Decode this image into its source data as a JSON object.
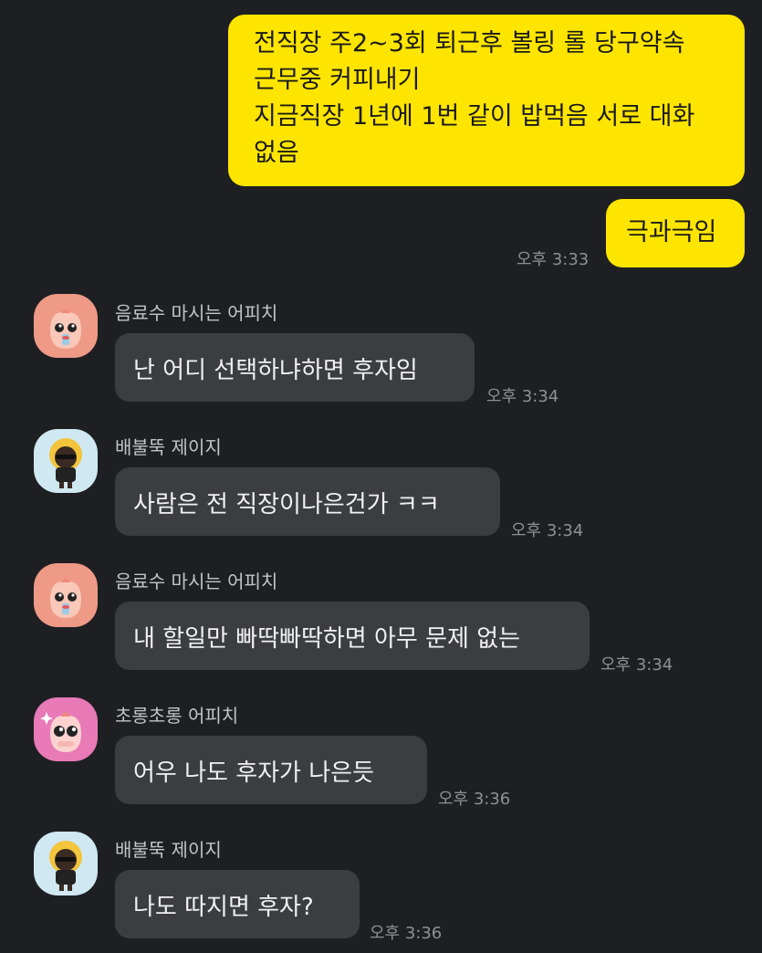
{
  "messages_out": {
    "main_lines": [
      "전직장 주2~3회 퇴근후 볼링 롤 당구약속",
      "근무중 커피내기",
      "지금직장 1년에 1번 같이 밥먹음 서로 대화",
      "없음"
    ],
    "second": "극과극임",
    "time": "오후 3:33"
  },
  "messages_in": [
    {
      "sender": "음료수 마시는 어피치",
      "text": "난 어디 선택하냐하면 후자임",
      "time": "오후 3:34"
    },
    {
      "sender": "배불뚝 제이지",
      "text": "사람은 전 직장이나은건가 ㅋㅋ",
      "time": "오후 3:34"
    },
    {
      "sender": "음료수 마시는 어피치",
      "text": "내 할일만 빠딱빠딱하면 아무 문제 없는",
      "time": "오후 3:34"
    },
    {
      "sender": "초롱초롱 어피치",
      "text": "어우 나도 후자가 나은듯",
      "time": "오후 3:36"
    },
    {
      "sender": "배불뚝 제이지",
      "text": "나도 따지면 후자?",
      "time": "오후 3:36"
    }
  ],
  "colors": {
    "background": "#1e1f22",
    "outgoing_bubble": "#fee500",
    "incoming_bubble": "#3c3d41",
    "timestamp": "#8f9095"
  },
  "avatar_icons": [
    "apeach-drink-icon",
    "jayg-icon",
    "apeach-drink-icon",
    "apeach-sparkle-icon",
    "jayg-icon"
  ]
}
